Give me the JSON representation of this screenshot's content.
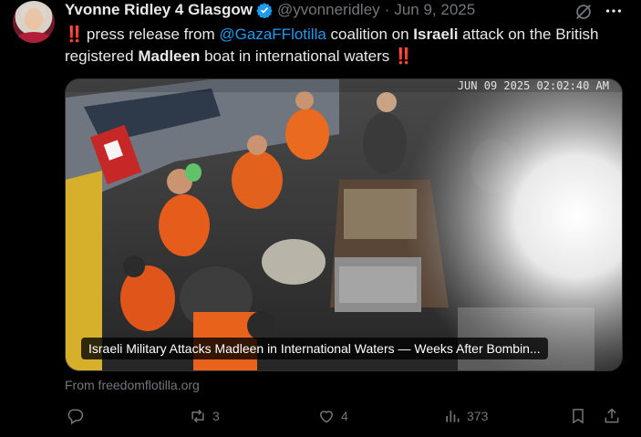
{
  "post": {
    "author_name": "Yvonne Ridley 4 Glasgow",
    "handle": "@yvonneridley",
    "separator": "·",
    "date": "Jun 9, 2025",
    "text_prefix": "‼️",
    "text_1": " press release from ",
    "mention": "@GazaFFlotilla",
    "text_2": " coalition on ",
    "bold_1": "Israeli",
    "text_3": " attack on the British registered ",
    "bold_2": "Madleen",
    "text_4": " boat in international waters ",
    "text_suffix": "‼️"
  },
  "media": {
    "timestamp": "JUN 09 2025  02:02:40 AM",
    "caption": "Israeli Military Attacks Madleen in International Waters — Weeks After Bombin..."
  },
  "link_source": "From freedomflotilla.org",
  "actions": {
    "replies": "",
    "reposts": "3",
    "likes": "4",
    "views": "373"
  },
  "icons": {
    "verified": "verified-badge-icon",
    "grok": "grok-icon",
    "more": "more-icon",
    "reply": "reply-icon",
    "repost": "repost-icon",
    "like": "heart-icon",
    "views": "views-icon",
    "bookmark": "bookmark-icon",
    "share": "share-icon"
  },
  "colors": {
    "background": "#000000",
    "text": "#e7e9ea",
    "secondary": "#71767b",
    "accent": "#1d9bf0",
    "alert": "#f4212e"
  }
}
